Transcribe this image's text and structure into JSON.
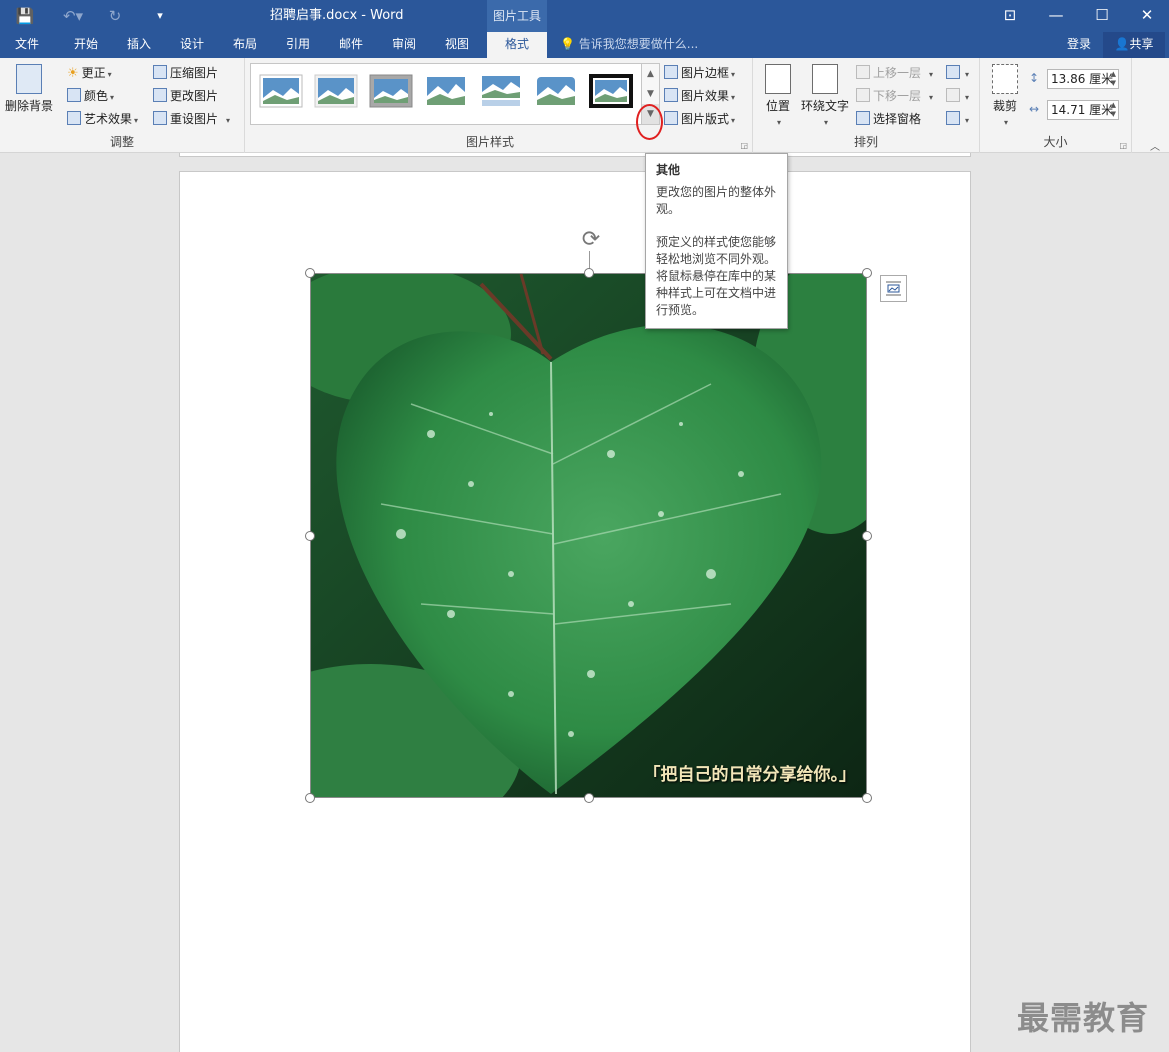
{
  "titlebar": {
    "doc_title": "招聘启事.docx - Word",
    "context_tool": "图片工具"
  },
  "tabs": [
    "文件",
    "开始",
    "插入",
    "设计",
    "布局",
    "引用",
    "邮件",
    "审阅",
    "视图",
    "格式"
  ],
  "active_tab": "格式",
  "tellme": "告诉我您想要做什么...",
  "login": "登录",
  "share": "共享",
  "ribbon": {
    "adjust": {
      "label": "调整",
      "remove_bg": "删除背景",
      "corrections": "更正",
      "color": "颜色",
      "artistic": "艺术效果",
      "compress": "压缩图片",
      "change_pic": "更改图片",
      "reset_pic": "重设图片"
    },
    "styles": {
      "label": "图片样式",
      "border": "图片边框",
      "effects": "图片效果",
      "layout": "图片版式"
    },
    "arrange": {
      "label": "排列",
      "position": "位置",
      "wrap_text": "环绕文字",
      "bring_forward": "上移一层",
      "send_backward": "下移一层",
      "selection_pane": "选择窗格"
    },
    "size": {
      "label": "大小",
      "crop": "裁剪",
      "height": "13.86 厘米",
      "width": "14.71 厘米"
    }
  },
  "tooltip": {
    "title": "其他",
    "p1": "更改您的图片的整体外观。",
    "p2": "预定义的样式使您能够轻松地浏览不同外观。将鼠标悬停在库中的某种样式上可在文档中进行预览。"
  },
  "picture": {
    "caption": "「把自己的日常分享给你。」"
  },
  "watermark": "最需教育",
  "colors": {
    "accent": "#2b579a",
    "leaf": "#2e8b45"
  }
}
